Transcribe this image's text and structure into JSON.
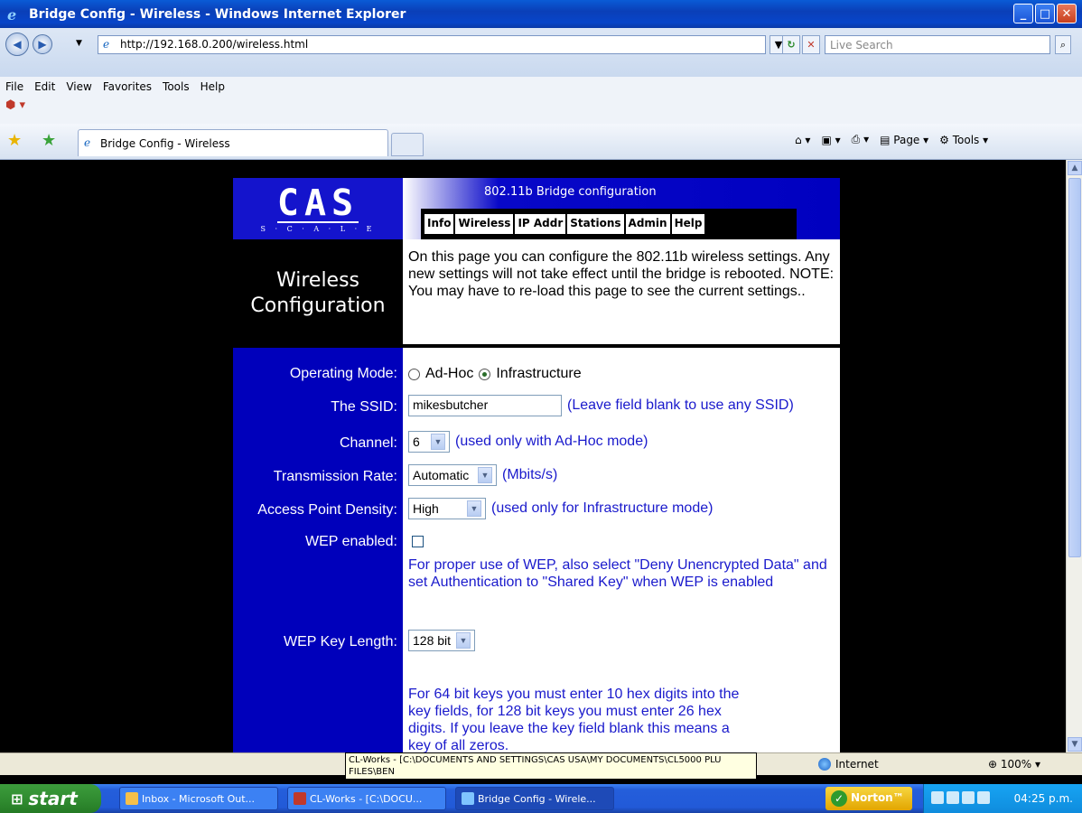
{
  "window": {
    "title": "Bridge Config - Wireless - Windows Internet Explorer"
  },
  "address_bar": {
    "url": "http://192.168.0.200/wireless.html",
    "search_placeholder": "Live Search"
  },
  "menu": [
    "File",
    "Edit",
    "View",
    "Favorites",
    "Tools",
    "Help"
  ],
  "browser_tab": {
    "label": "Bridge Config - Wireless"
  },
  "command_bar": {
    "page_label": "Page",
    "tools_label": "Tools"
  },
  "page": {
    "logo_text": "CAS",
    "logo_subtext": "S · C · A · L · E",
    "header_title": "802.11b Bridge configuration",
    "nav_tabs": [
      "Info",
      "Wireless",
      "IP Addr",
      "Stations",
      "Admin",
      "Help"
    ],
    "side_title_line1": "Wireless",
    "side_title_line2": "Configuration",
    "intro_text": "On this page you can configure the 802.11b wireless settings. Any new settings will not take effect until the bridge is rebooted. NOTE: You may have to re-load this page to see the current settings..",
    "form": {
      "operating_mode": {
        "label": "Operating Mode:",
        "options": [
          "Ad-Hoc",
          "Infrastructure"
        ],
        "selected": "Infrastructure"
      },
      "ssid": {
        "label": "The SSID:",
        "value": "mikesbutcher",
        "hint": "(Leave field blank to use any SSID)"
      },
      "channel": {
        "label": "Channel:",
        "value": "6",
        "hint": "(used only with Ad-Hoc mode)"
      },
      "transmission_rate": {
        "label": "Transmission Rate:",
        "value": "Automatic",
        "hint": "(Mbits/s)"
      },
      "ap_density": {
        "label": "Access Point Density:",
        "value": "High",
        "hint": "(used only for Infrastructure mode)"
      },
      "wep_enabled": {
        "label": "WEP enabled:",
        "checked": false
      },
      "wep_note": "For proper use of WEP, also select \"Deny Unencrypted Data\" and set Authentication to \"Shared Key\" when WEP is enabled",
      "wep_key_length": {
        "label": "WEP Key Length:",
        "value": "128 bit"
      },
      "key_note": "For 64 bit keys you must enter 10 hex digits into the key fields, for 128 bit keys you must enter 26 hex digits. If you leave the key field blank this means a key of all zeros."
    }
  },
  "status_bar": {
    "tooltip": "CL-Works - [C:\\DOCUMENTS AND SETTINGS\\CAS USA\\MY DOCUMENTS\\CL5000 PLU FILES\\BEN",
    "zone": "Internet",
    "zoom": "100%"
  },
  "taskbar": {
    "start_label": "start",
    "tasks": [
      "Inbox - Microsoft Out...",
      "CL-Works - [C:\\DOCU...",
      "Bridge Config - Wirele..."
    ],
    "norton_label": "Norton™",
    "clock": "04:25 p.m."
  },
  "colors": {
    "page_blue": "#0000bb",
    "link_blue": "#1a1acc",
    "xp_taskbar": "#245edb"
  }
}
